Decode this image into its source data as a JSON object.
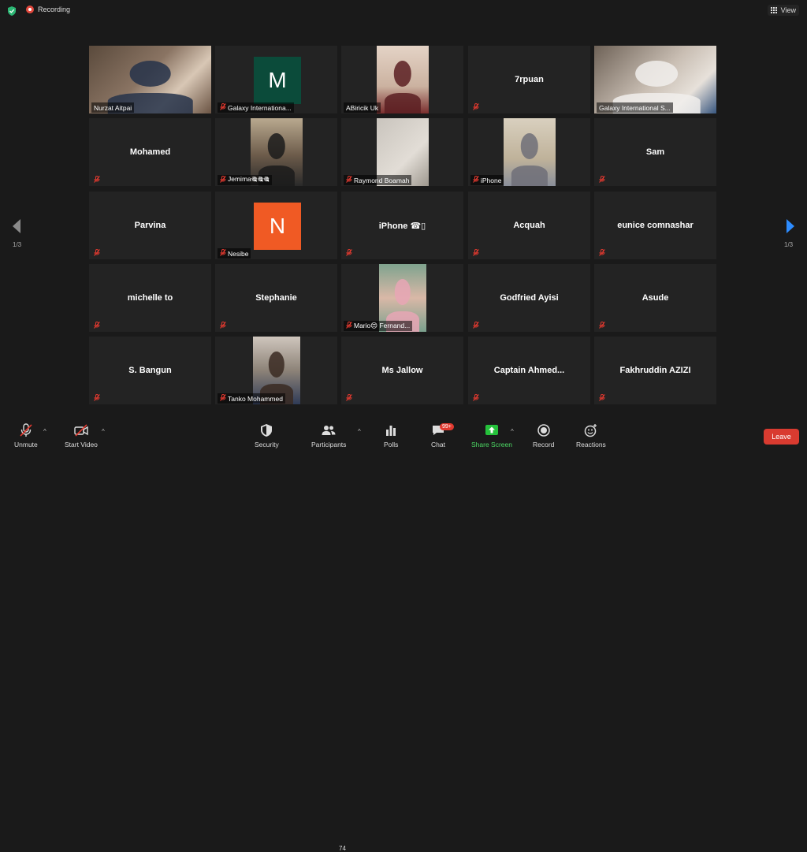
{
  "topbar": {
    "recording_label": "Recording",
    "view_label": "View"
  },
  "colors": {
    "accent_active": "#c8e36a",
    "record_red": "#e2483d",
    "leave_red": "#d93b30",
    "share_green": "#25c13b",
    "nav_blue": "#2d8cff"
  },
  "pagination": {
    "left_indicator": "1/3",
    "right_indicator": "1/3"
  },
  "participants": [
    {
      "name": "Nurzat Aitpai",
      "muted": false,
      "display": "video"
    },
    {
      "name": "Galaxy Internationa...",
      "muted": true,
      "display": "avatar",
      "letter": "M",
      "color": "#0b4b3a"
    },
    {
      "name": "ABiricik Uk",
      "muted": false,
      "display": "video"
    },
    {
      "name": "7rpuan",
      "muted": true,
      "display": "name"
    },
    {
      "name": "Galaxy International S...",
      "muted": false,
      "display": "video",
      "active": true
    },
    {
      "name": "Mohamed",
      "muted": true,
      "display": "name"
    },
    {
      "name": "Jemima🎕🎕🎕",
      "muted": true,
      "display": "video"
    },
    {
      "name": "Raymond Boamah",
      "muted": true,
      "display": "video"
    },
    {
      "name": "iPhone",
      "muted": true,
      "display": "video"
    },
    {
      "name": "Sam",
      "muted": true,
      "display": "name"
    },
    {
      "name": "Parvina",
      "muted": true,
      "display": "name"
    },
    {
      "name": "Nesibe",
      "muted": true,
      "display": "avatar",
      "letter": "N",
      "color": "#f05a24"
    },
    {
      "name": "iPhone ☎▯",
      "muted": true,
      "display": "name"
    },
    {
      "name": "Acquah",
      "muted": true,
      "display": "name"
    },
    {
      "name": "eunice comnashar",
      "muted": true,
      "display": "name"
    },
    {
      "name": "michelle to",
      "muted": true,
      "display": "name"
    },
    {
      "name": "Stephanie",
      "muted": true,
      "display": "name"
    },
    {
      "name": "Mario😍 Fernand...",
      "muted": true,
      "display": "video"
    },
    {
      "name": "Godfried Ayisi",
      "muted": true,
      "display": "name"
    },
    {
      "name": "Asude",
      "muted": true,
      "display": "name"
    },
    {
      "name": "S. Bangun",
      "muted": true,
      "display": "name"
    },
    {
      "name": "Tanko Mohammed",
      "muted": true,
      "display": "video"
    },
    {
      "name": "Ms Jallow",
      "muted": true,
      "display": "name"
    },
    {
      "name": "Captain  Ahmed...",
      "muted": true,
      "display": "name"
    },
    {
      "name": "Fakhruddin AZIZI",
      "muted": true,
      "display": "name"
    }
  ],
  "toolbar": {
    "unmute": "Unmute",
    "start_video": "Start Video",
    "security": "Security",
    "participants": "Participants",
    "participants_count": "74",
    "polls": "Polls",
    "chat": "Chat",
    "chat_badge": "99+",
    "share_screen": "Share Screen",
    "record": "Record",
    "reactions": "Reactions",
    "leave": "Leave"
  }
}
